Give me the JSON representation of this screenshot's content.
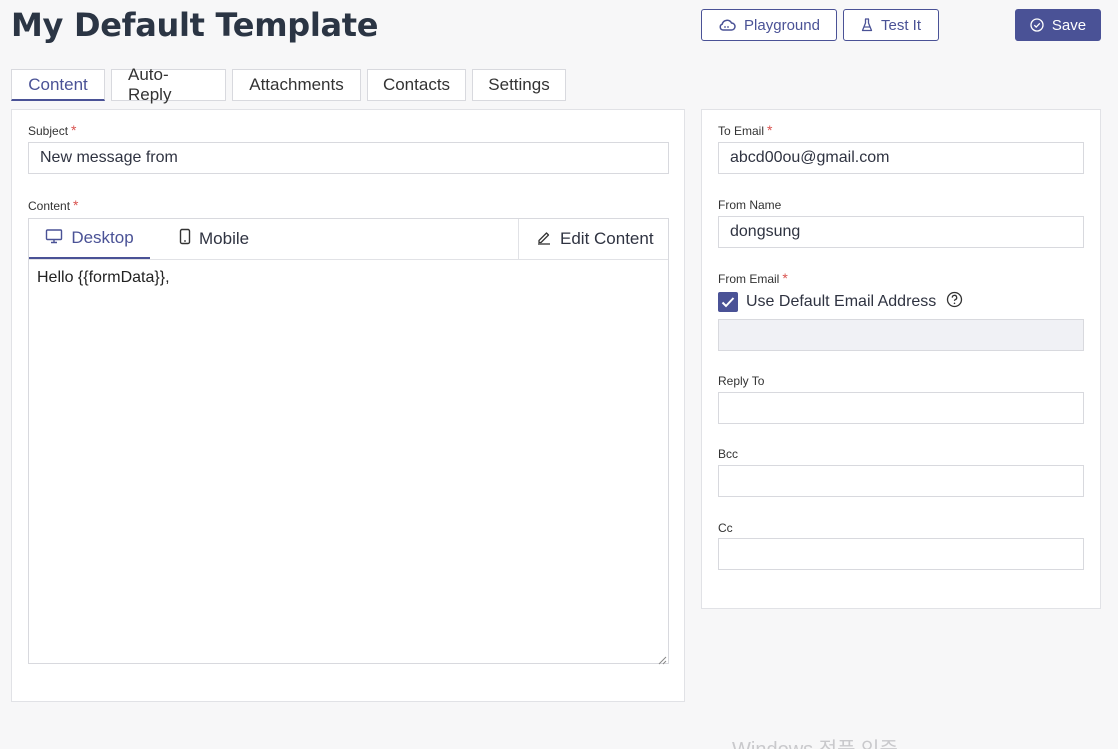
{
  "header": {
    "title": "My Default Template",
    "playground_label": "Playground",
    "testit_label": "Test It",
    "save_label": "Save"
  },
  "tabs": [
    {
      "label": "Content",
      "active": true
    },
    {
      "label": "Auto-Reply"
    },
    {
      "label": "Attachments"
    },
    {
      "label": "Contacts"
    },
    {
      "label": "Settings"
    }
  ],
  "content_panel": {
    "subject_label": "Subject",
    "subject_value": "New message from",
    "content_label": "Content",
    "editor_tabs": {
      "desktop": "Desktop",
      "mobile": "Mobile",
      "edit": "Edit Content"
    },
    "editor_text": "Hello {{formData}},"
  },
  "side_panel": {
    "to_email_label": "To Email",
    "to_email_value": "abcd00ou@gmail.com",
    "from_name_label": "From Name",
    "from_name_value": "dongsung",
    "from_email_label": "From Email",
    "use_default_label": "Use Default Email Address",
    "use_default_checked": true,
    "reply_to_label": "Reply To",
    "bcc_label": "Bcc",
    "cc_label": "Cc"
  },
  "required_mark": "*",
  "watermark": "Windows 정품 인증",
  "colors": {
    "accent": "#4a5296",
    "required": "#d9534f"
  }
}
